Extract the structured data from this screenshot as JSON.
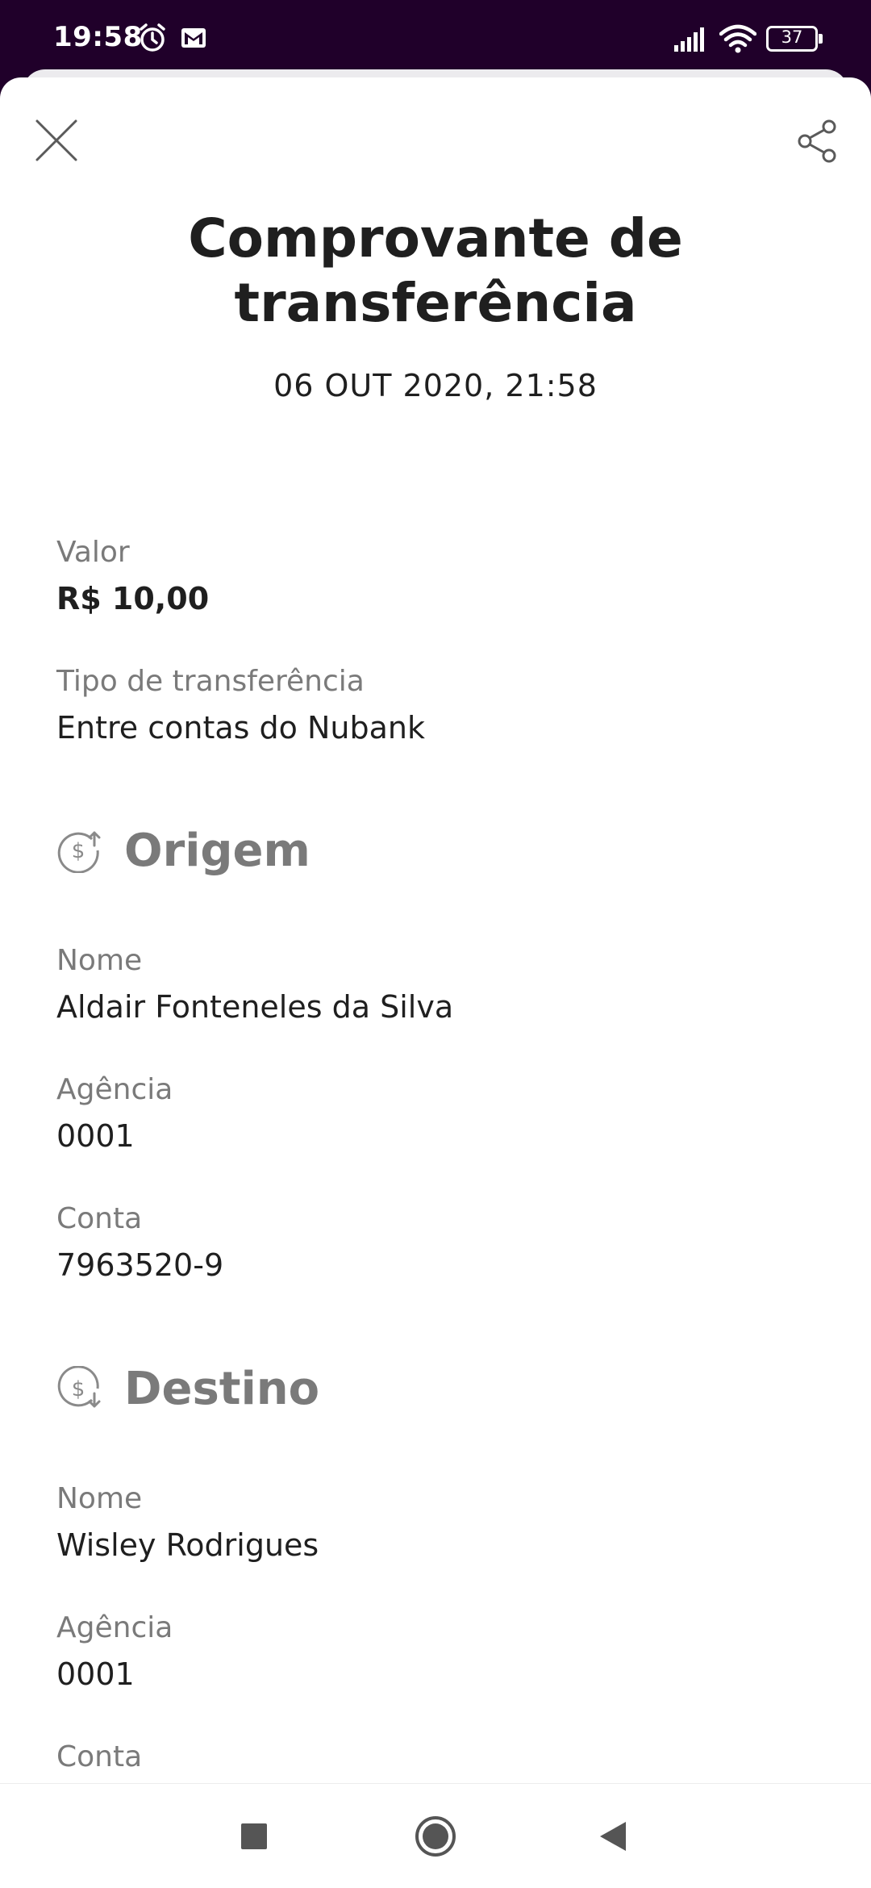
{
  "status_bar": {
    "time": "19:58",
    "battery": "37",
    "icons": [
      "alarm-icon",
      "gmail-icon",
      "signal-icon",
      "wifi-icon",
      "battery-icon"
    ]
  },
  "header": {
    "close_icon": "close-icon",
    "share_icon": "share-icon",
    "title_line1": "Comprovante de",
    "title_line2": "transferência",
    "date": "06 OUT 2020, 21:58"
  },
  "details": {
    "valor_label": "Valor",
    "valor_value": "R$ 10,00",
    "tipo_label": "Tipo de transferência",
    "tipo_value": "Entre contas do Nubank"
  },
  "origem": {
    "title": "Origem",
    "icon": "money-out-icon",
    "nome_label": "Nome",
    "nome_value": "Aldair Fonteneles da Silva",
    "agencia_label": "Agência",
    "agencia_value": "0001",
    "conta_label": "Conta",
    "conta_value": "7963520-9"
  },
  "destino": {
    "title": "Destino",
    "icon": "money-in-icon",
    "nome_label": "Nome",
    "nome_value": "Wisley Rodrigues",
    "agencia_label": "Agência",
    "agencia_value": "0001",
    "conta_label": "Conta"
  },
  "nav_bar": {
    "icons": [
      "recents-icon",
      "home-icon",
      "back-icon"
    ]
  },
  "colors": {
    "status_bg": "#20002a",
    "text_primary": "#1f1f1f",
    "text_secondary": "#7a7a7a"
  }
}
